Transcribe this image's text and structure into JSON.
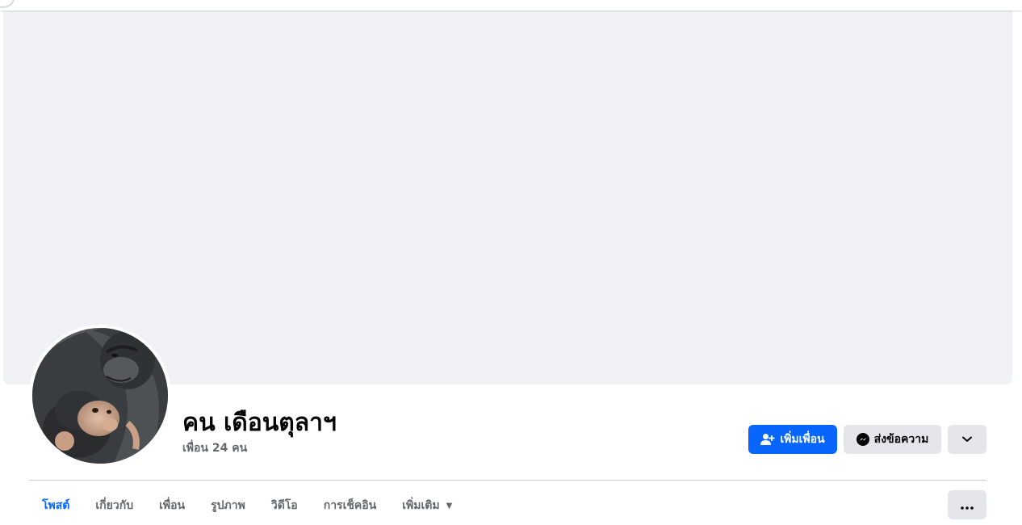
{
  "profile": {
    "name": "คน เดือนตุลาฯ",
    "friends_count_text": "เพื่อน 24 คน"
  },
  "actions": {
    "add_friend_label": "เพิ่มเพื่อน",
    "message_label": "ส่งข้อความ"
  },
  "tabs": [
    {
      "label": "โพสต์",
      "active": true
    },
    {
      "label": "เกี่ยวกับ",
      "active": false
    },
    {
      "label": "เพื่อน",
      "active": false
    },
    {
      "label": "รูปภาพ",
      "active": false
    },
    {
      "label": "วิดีโอ",
      "active": false
    },
    {
      "label": "การเช็คอิน",
      "active": false
    },
    {
      "label": "เพิ่มเติม",
      "active": false
    }
  ],
  "icons": {
    "add_friend": "add-person-icon",
    "message": "messenger-icon",
    "dropdown": "chevron-down-icon",
    "more_tab_caret": "caret-down-icon",
    "overflow": "more-dots-icon"
  },
  "colors": {
    "primary": "#0866ff",
    "secondary_button": "#e4e6eb",
    "cover_placeholder": "#f0f2f5",
    "text_primary": "#050505",
    "text_secondary": "#65676b"
  }
}
